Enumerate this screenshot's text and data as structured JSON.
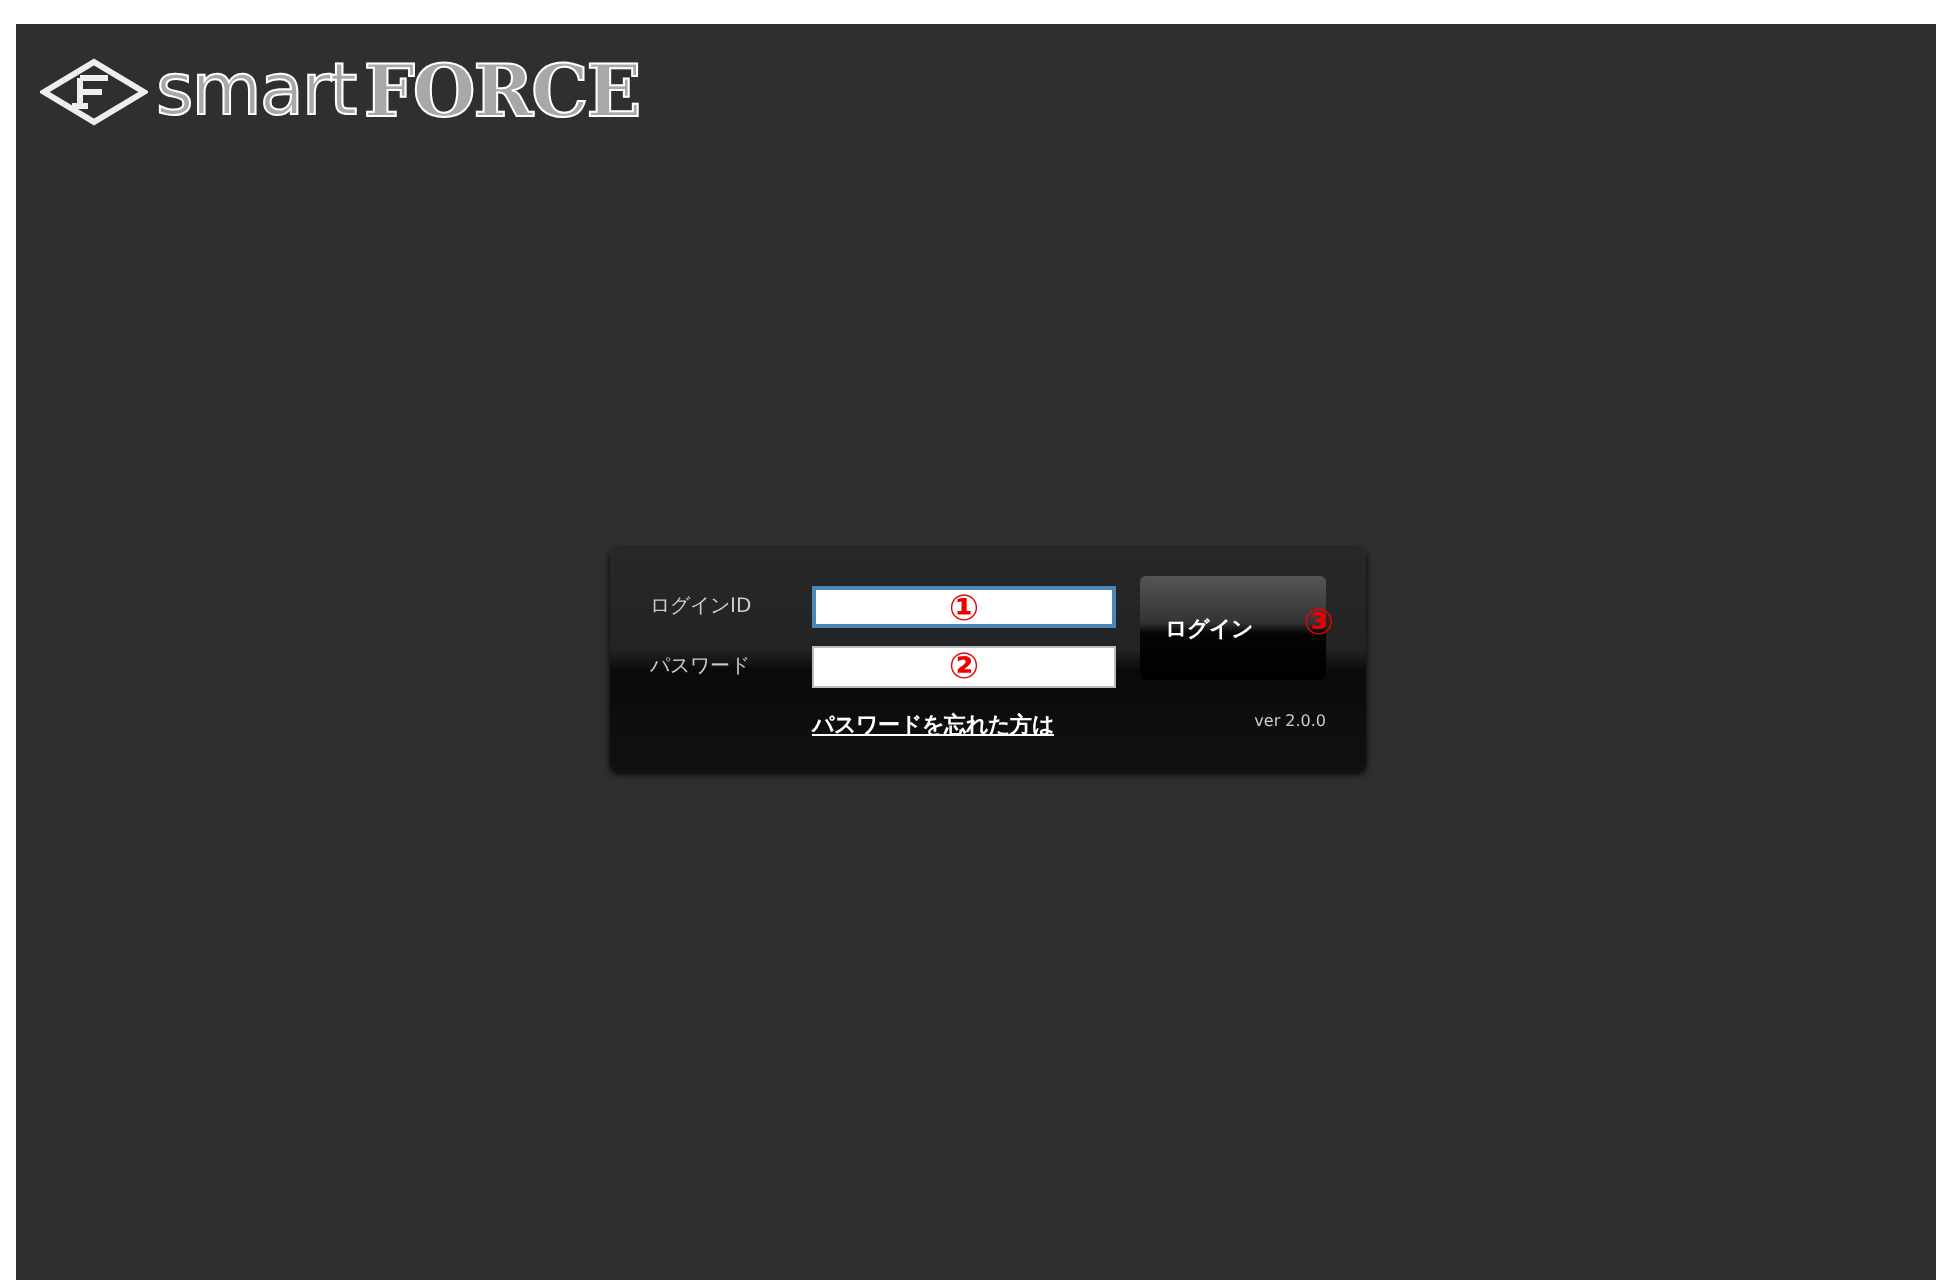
{
  "logo": {
    "text_1": "smart",
    "text_2": "FORCE"
  },
  "login_form": {
    "fields": [
      {
        "label": "ログインID",
        "marker": "①",
        "focused": true
      },
      {
        "label": "パスワード",
        "marker": "②",
        "focused": false
      }
    ],
    "button": {
      "label": "ログイン",
      "marker": "③"
    },
    "forgot_link": "パスワードを忘れた方は",
    "version": "ver 2.0.0"
  }
}
